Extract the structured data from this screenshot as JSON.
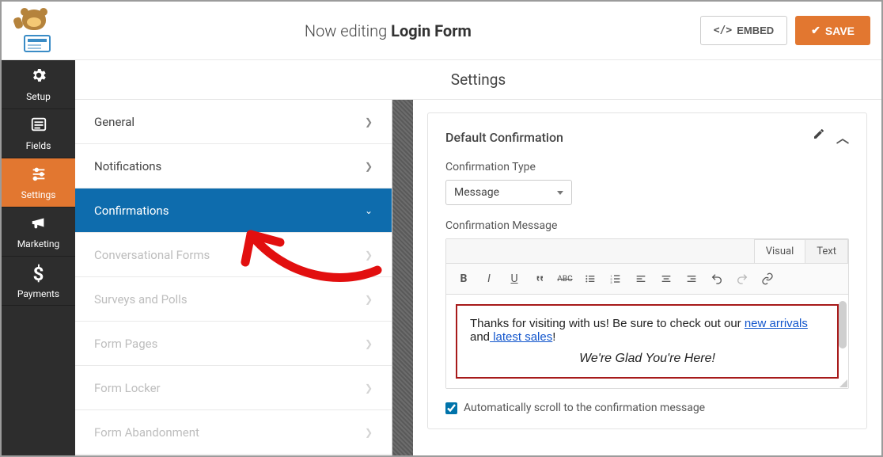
{
  "header": {
    "editing_prefix": "Now editing ",
    "form_name": "Login Form",
    "embed_label": "EMBED",
    "save_label": "SAVE"
  },
  "nav": {
    "setup": "Setup",
    "fields": "Fields",
    "settings": "Settings",
    "marketing": "Marketing",
    "payments": "Payments"
  },
  "page_title": "Settings",
  "settings_menu": {
    "general": "General",
    "notifications": "Notifications",
    "confirmations": "Confirmations",
    "conversational_forms": "Conversational Forms",
    "surveys_polls": "Surveys and Polls",
    "form_pages": "Form Pages",
    "form_locker": "Form Locker",
    "form_abandonment": "Form Abandonment"
  },
  "panel": {
    "title": "Default Confirmation",
    "type_label": "Confirmation Type",
    "type_value": "Message",
    "message_label": "Confirmation Message",
    "tabs": {
      "visual": "Visual",
      "text": "Text"
    },
    "message": {
      "part1": "Thanks for visiting with us! Be sure to check out our ",
      "link1": "new arrivals",
      "part2": " and",
      "link2": " latest sales",
      "part3": "!",
      "line2": "We're Glad You're Here!"
    },
    "autoscroll_label": "Automatically scroll to the confirmation message",
    "autoscroll_checked": true
  }
}
